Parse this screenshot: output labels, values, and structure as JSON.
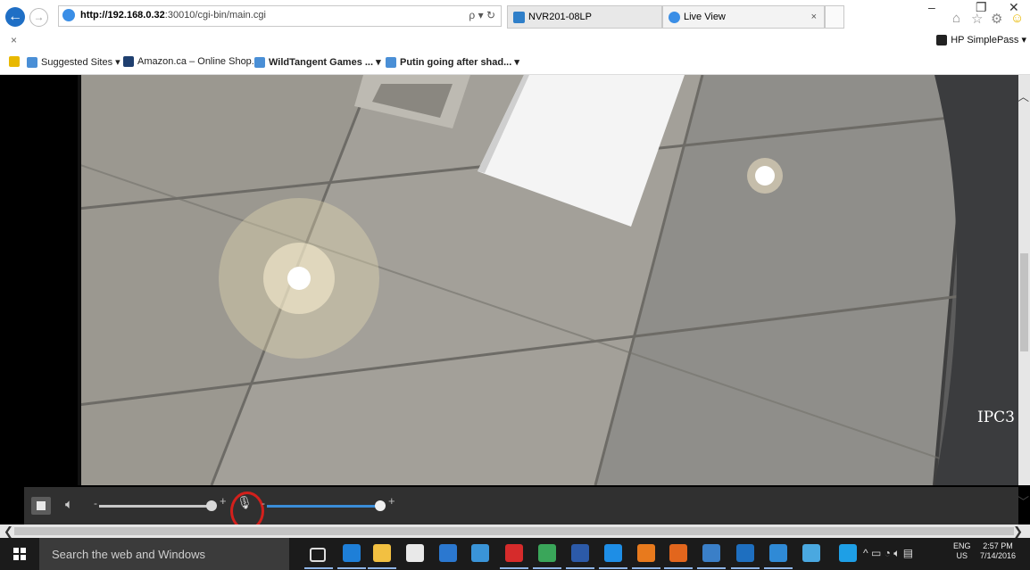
{
  "browser": {
    "url_host": "http://192.168.0.32",
    "url_rest": ":30010/cgi-bin/main.cgi",
    "search_refresh": "ρ ▾ ↻",
    "tabs": [
      {
        "label": "NVR201-08LP",
        "icon_color": "#2f7fc9"
      },
      {
        "label": "Live View",
        "icon_color": "#3a8ee6",
        "close": "×"
      }
    ],
    "window_controls": {
      "minimize": "–",
      "maximize": "❐",
      "close": "✕"
    },
    "close_bar": "×",
    "simplepass": "HP SimplePass ▾",
    "favorites": [
      {
        "label": "Suggested Sites ▾",
        "icon_color": "#4a8fd6"
      },
      {
        "label": "Amazon.ca – Online Shop...",
        "icon_color": "#1f3f6f"
      },
      {
        "label": "WildTangent Games ...  ▾",
        "icon_color": "#4a8fd6"
      },
      {
        "label": "Putin going after shad...  ▾",
        "icon_color": "#4a8fd6"
      }
    ]
  },
  "video": {
    "camera_label": "IPC3"
  },
  "controls": {
    "volume_level": 0.95,
    "mic_level": 0.97,
    "minus": "-",
    "plus": "+"
  },
  "taskbar": {
    "search_placeholder": "Search the web and Windows",
    "lang_top": "ENG",
    "lang_bottom": "US",
    "time": "2:57 PM",
    "date": "7/14/2016",
    "apps": [
      {
        "name": "task-view",
        "color": "#1b1b1b"
      },
      {
        "name": "edge",
        "color": "#1e7fd8"
      },
      {
        "name": "file-explorer",
        "color": "#f2c041"
      },
      {
        "name": "store",
        "color": "#e9e9e9"
      },
      {
        "name": "media",
        "color": "#2b78d0"
      },
      {
        "name": "app5",
        "color": "#3a94d8"
      },
      {
        "name": "acrobat",
        "color": "#d62b2b"
      },
      {
        "name": "app7",
        "color": "#3aa65a"
      },
      {
        "name": "word",
        "color": "#2c5aa8"
      },
      {
        "name": "internet-explorer",
        "color": "#1e8ee6"
      },
      {
        "name": "outlook",
        "color": "#e87a1d"
      },
      {
        "name": "firefox",
        "color": "#e2661d"
      },
      {
        "name": "app11",
        "color": "#3a7fc8"
      },
      {
        "name": "app12",
        "color": "#1e6fc0"
      },
      {
        "name": "app13",
        "color": "#2f8ad6"
      },
      {
        "name": "app14",
        "color": "#4aa8e0"
      },
      {
        "name": "app15",
        "color": "#1e9fe6"
      }
    ]
  }
}
